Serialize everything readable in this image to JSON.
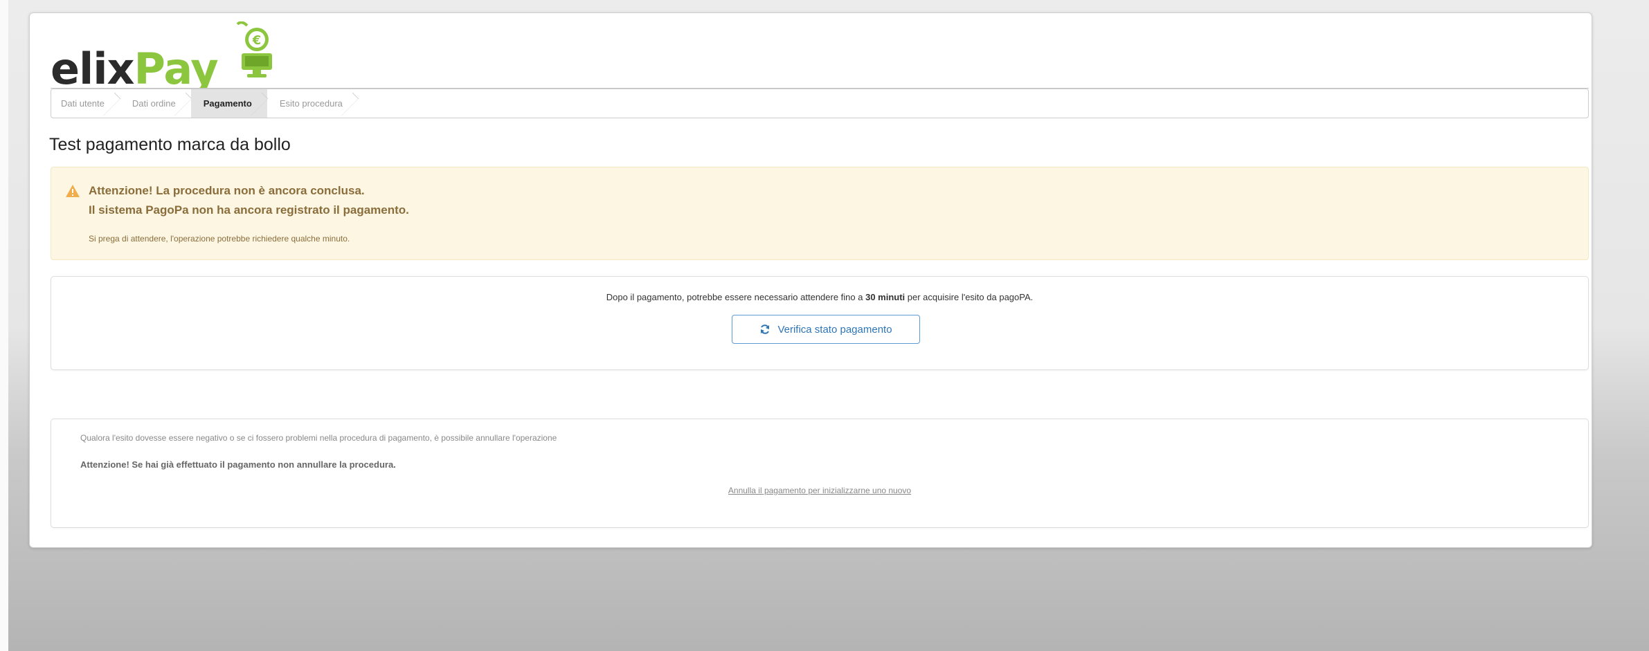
{
  "logo": {
    "elix": "elix",
    "pay": "Pay",
    "icon": "monitor-euro-icon"
  },
  "breadcrumb": {
    "steps": [
      "Dati utente",
      "Dati ordine",
      "Pagamento",
      "Esito procedura"
    ],
    "active_index": 2
  },
  "page_title": "Test pagamento marca da bollo",
  "alert": {
    "icon": "warning-triangle-icon",
    "line1": "Attenzione! La procedura non è ancora conclusa.",
    "line2": "Il sistema PagoPa non ha ancora registrato il pagamento.",
    "note": "Si prega di attendere, l'operazione potrebbe richiedere qualche minuto."
  },
  "verify_panel": {
    "text_before": "Dopo il pagamento, potrebbe essere necessario attendere fino a ",
    "text_bold": "30 minuti",
    "text_after": " per acquisire l'esito da pagoPA.",
    "button_label": "Verifica stato pagamento",
    "button_icon": "refresh-icon"
  },
  "cancel_panel": {
    "line1": "Qualora l'esito dovesse essere negativo o se ci fossero problemi nella procedura di pagamento, è possibile annullare l'operazione",
    "line2": "Attenzione! Se hai già effettuato il pagamento non annullare la procedura.",
    "link": "Annulla il pagamento per inizializzarne uno nuovo"
  },
  "colors": {
    "brand_green": "#8cc63f",
    "alert_bg": "#fcf6e3",
    "alert_text": "#8a6d3b",
    "warning_icon": "#f0ad4e",
    "button_blue": "#2e75b6"
  }
}
